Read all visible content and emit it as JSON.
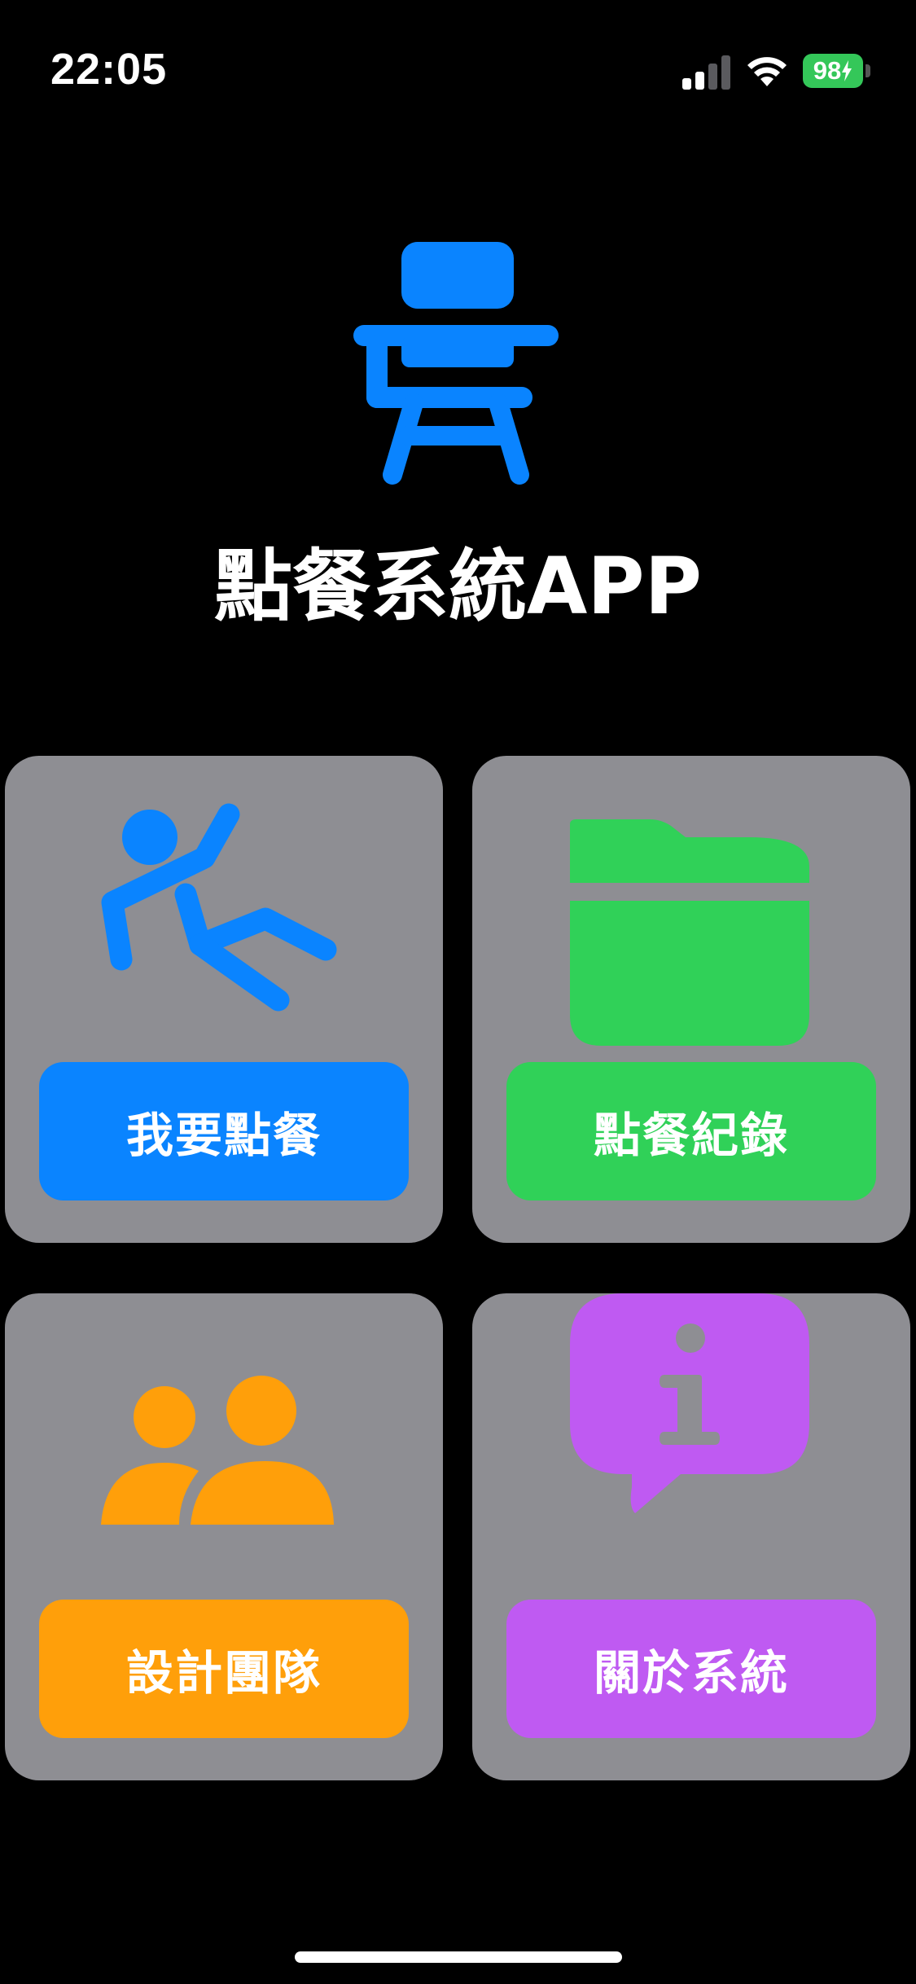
{
  "status_bar": {
    "time": "22:05",
    "battery_percent": "98"
  },
  "app": {
    "title": "點餐系統APP",
    "accent_color": "#0a84ff",
    "hero_icon": "school-desk-chair-icon"
  },
  "menu": {
    "cards": [
      {
        "label": "我要點餐",
        "icon": "person-falling-icon",
        "color": "#0a84ff"
      },
      {
        "label": "點餐紀錄",
        "icon": "folder-icon",
        "color": "#30d158"
      },
      {
        "label": "設計團隊",
        "icon": "two-people-icon",
        "color": "#ff9f0a"
      },
      {
        "label": "關於系統",
        "icon": "info-bubble-icon",
        "color": "#bf5af2"
      }
    ]
  }
}
